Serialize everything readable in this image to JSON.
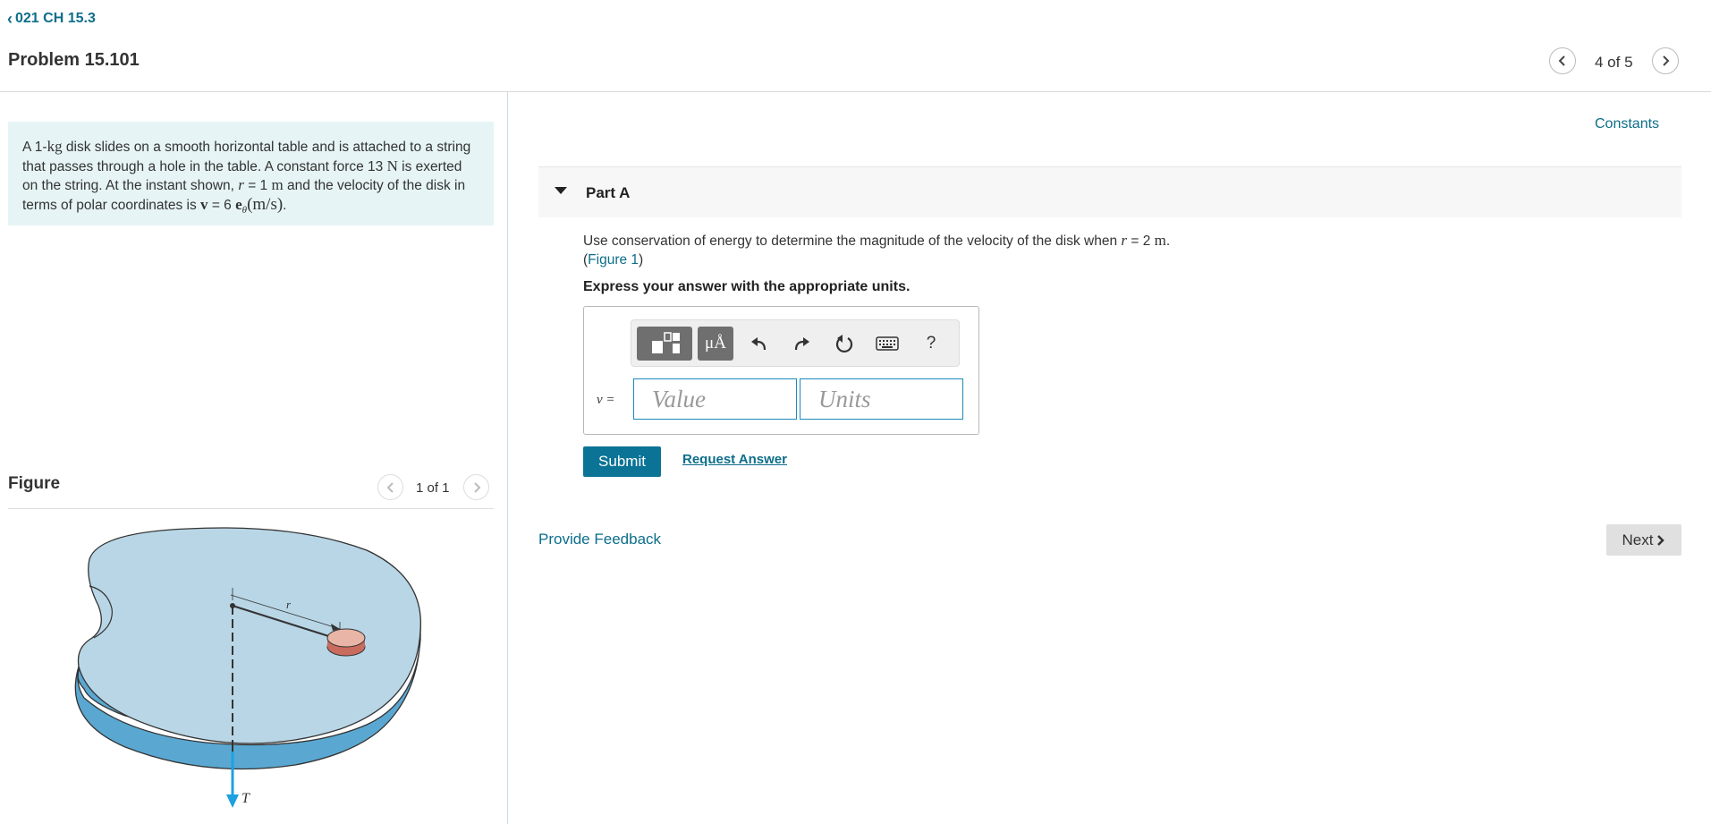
{
  "header": {
    "breadcrumb": "021 CH 15.3",
    "problem_title": "Problem 15.101",
    "pager": "4 of 5"
  },
  "problem": {
    "t1": "A 1-",
    "kg": "kg",
    "t2": " disk slides on a smooth horizontal table and is attached to a string that passes through a hole in the table. A constant force 13 ",
    "N": "N",
    "t3": " is exerted on the string. At the instant shown, ",
    "r": "r",
    "t4": " = 1 ",
    "m": "m",
    "t5": " and the velocity of the disk in terms of polar coordinates is ",
    "v": "v",
    "t6": " = 6 ",
    "e": "e",
    "theta": "θ",
    "unit": "(m/s)",
    "t7": "."
  },
  "figure": {
    "label": "Figure",
    "count": "1 of 1",
    "r_label": "r",
    "t_label": "T"
  },
  "constants_link": "Constants",
  "part_a": {
    "label": "Part A",
    "q1": "Use conservation of energy to determine the magnitude of the velocity of the disk when ",
    "r": "r",
    "q2": " = 2 ",
    "m": "m",
    "q3": ".",
    "fig_open": "(",
    "fig_link": "Figure 1",
    "fig_close": ")",
    "express": "Express your answer with the appropriate units.",
    "toolbar": {
      "units_symbol": "μÅ",
      "help": "?"
    },
    "var_label": "v =",
    "value_placeholder": "Value",
    "units_placeholder": "Units",
    "submit": "Submit",
    "request": "Request Answer"
  },
  "feedback": "Provide Feedback",
  "next": "Next"
}
